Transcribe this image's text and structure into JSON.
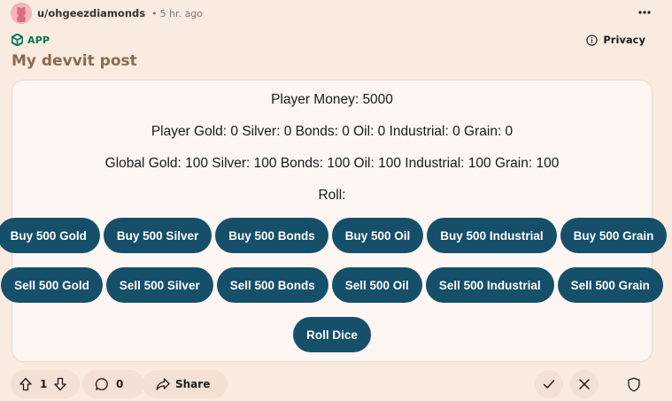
{
  "post": {
    "username": "u/ohgeezdiamonds",
    "dot": "•",
    "time": "5 hr. ago",
    "app_label": "APP",
    "privacy_label": "Privacy",
    "title": "My devvit post"
  },
  "app": {
    "player_money": "Player Money: 5000",
    "player_holdings": "Player Gold: 0 Silver: 0 Bonds: 0 Oil: 0 Industrial: 0 Grain: 0",
    "global_holdings": "Global Gold: 100 Silver: 100 Bonds: 100 Oil: 100 Industrial: 100 Grain: 100",
    "roll": "Roll:",
    "buy_buttons": [
      "Buy 500 Gold",
      "Buy 500 Silver",
      "Buy 500 Bonds",
      "Buy 500 Oil",
      "Buy 500 Industrial",
      "Buy 500 Grain"
    ],
    "sell_buttons": [
      "Sell 500 Gold",
      "Sell 500 Silver",
      "Sell 500 Bonds",
      "Sell 500 Oil",
      "Sell 500 Industrial",
      "Sell 500 Grain"
    ],
    "roll_button": "Roll Dice",
    "button_color": "#154f6a"
  },
  "footer": {
    "vote_count": "1",
    "comment_count": "0",
    "share_label": "Share"
  },
  "icons": [
    "avatar-icon",
    "more-icon",
    "app-icon",
    "info-icon",
    "upvote-icon",
    "downvote-icon",
    "comment-icon",
    "share-icon",
    "approve-icon",
    "remove-icon",
    "shield-icon"
  ]
}
